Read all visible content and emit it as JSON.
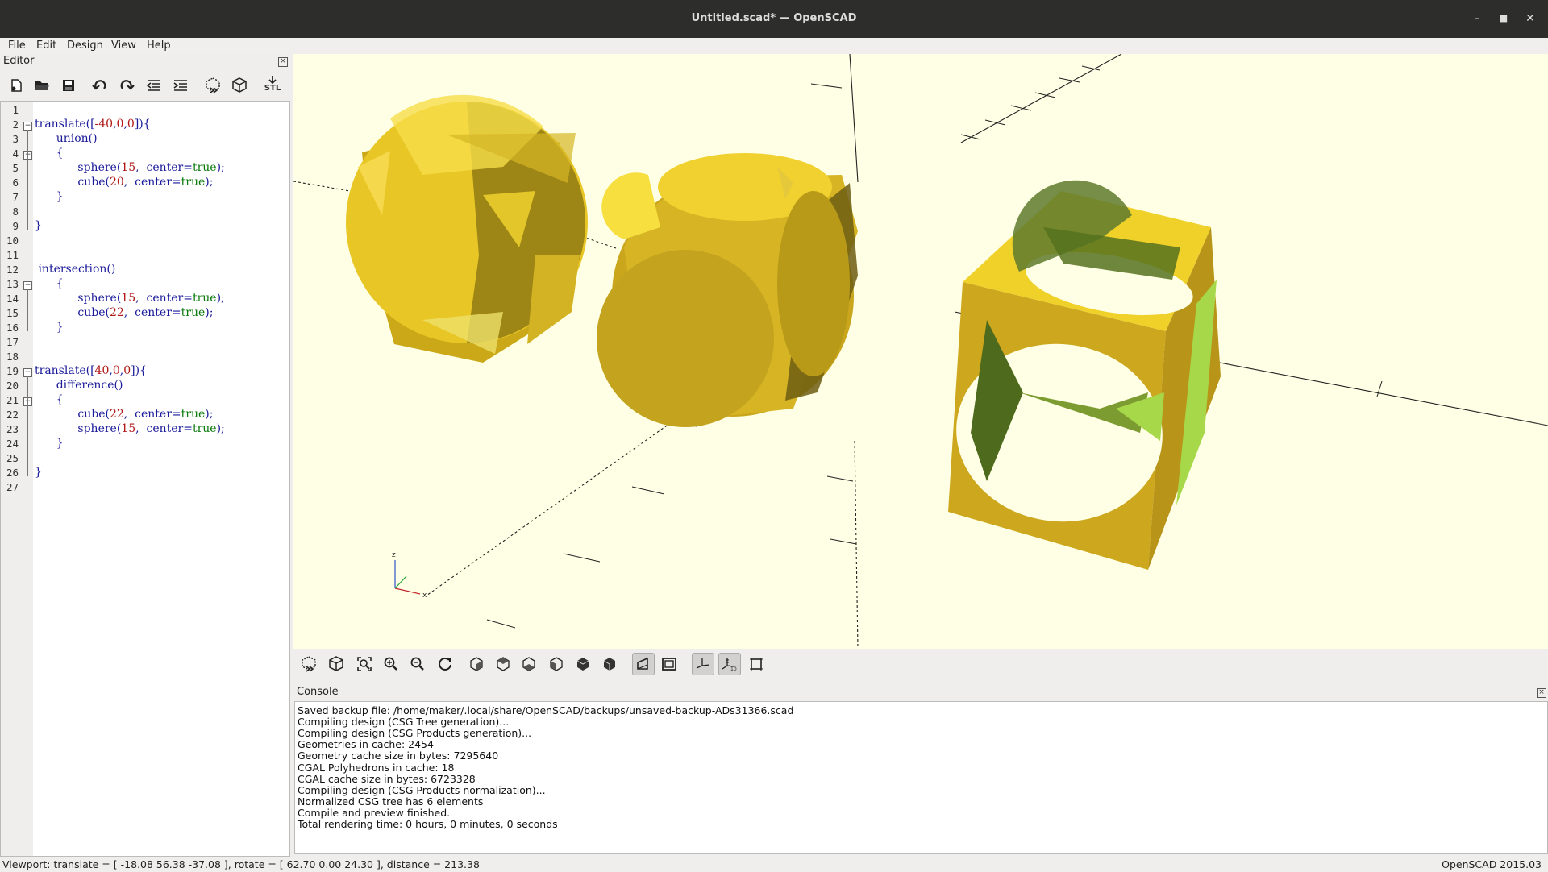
{
  "window": {
    "title": "Untitled.scad* — OpenSCAD"
  },
  "menu": [
    "File",
    "Edit",
    "Design",
    "View",
    "Help"
  ],
  "editor": {
    "label": "Editor",
    "lines": [
      {
        "n": "1",
        "html": ""
      },
      {
        "n": "2",
        "html": "translate([<span class='n'>-40</span>,<span class='n'>0</span>,<span class='n'>0</span>]){"
      },
      {
        "n": "3",
        "html": "      union()"
      },
      {
        "n": "4",
        "html": "      {"
      },
      {
        "n": "5",
        "html": "            sphere(<span class='n'>15</span>,  center=<span class='t'>true</span>);"
      },
      {
        "n": "6",
        "html": "            cube(<span class='n'>20</span>,  center=<span class='t'>true</span>);"
      },
      {
        "n": "7",
        "html": "      }"
      },
      {
        "n": "8",
        "html": ""
      },
      {
        "n": "9",
        "html": "}"
      },
      {
        "n": "10",
        "html": ""
      },
      {
        "n": "11",
        "html": ""
      },
      {
        "n": "12",
        "html": " intersection()"
      },
      {
        "n": "13",
        "html": "      {"
      },
      {
        "n": "14",
        "html": "            sphere(<span class='n'>15</span>,  center=<span class='t'>true</span>);"
      },
      {
        "n": "15",
        "html": "            cube(<span class='n'>22</span>,  center=<span class='t'>true</span>);"
      },
      {
        "n": "16",
        "html": "      }"
      },
      {
        "n": "17",
        "html": ""
      },
      {
        "n": "18",
        "html": ""
      },
      {
        "n": "19",
        "html": "translate([<span class='n'>40</span>,<span class='n'>0</span>,<span class='n'>0</span>]){"
      },
      {
        "n": "20",
        "html": "      difference()"
      },
      {
        "n": "21",
        "html": "      {"
      },
      {
        "n": "22",
        "html": "            cube(<span class='n'>22</span>,  center=<span class='t'>true</span>);"
      },
      {
        "n": "23",
        "html": "            sphere(<span class='n'>15</span>,  center=<span class='t'>true</span>);"
      },
      {
        "n": "24",
        "html": "      }"
      },
      {
        "n": "25",
        "html": ""
      },
      {
        "n": "26",
        "html": "}"
      },
      {
        "n": "27",
        "html": ""
      }
    ]
  },
  "console": {
    "label": "Console",
    "lines": [
      "Saved backup file: /home/maker/.local/share/OpenSCAD/backups/unsaved-backup-ADs31366.scad",
      "Compiling design (CSG Tree generation)...",
      "Compiling design (CSG Products generation)...",
      "Geometries in cache: 2454",
      "Geometry cache size in bytes: 7295640",
      "CGAL Polyhedrons in cache: 18",
      "CGAL cache size in bytes: 6723328",
      "Compiling design (CSG Products normalization)...",
      "Normalized CSG tree has 6 elements",
      "Compile and preview finished.",
      "Total rendering time: 0 hours, 0 minutes, 0 seconds"
    ]
  },
  "status": {
    "viewport": "Viewport: translate = [ -18.08 56.38 -37.08 ], rotate = [ 62.70 0.00 24.30 ], distance = 213.38",
    "version": "OpenSCAD 2015.03"
  },
  "toolbar": {
    "stl_label": "STL"
  },
  "axes": {
    "x": "x",
    "z": "z"
  },
  "colors": {
    "viewport_bg": "#ffffe5",
    "yellow": "#f2d22e",
    "shadow": "#a8901c",
    "green": "#a6d84a"
  }
}
